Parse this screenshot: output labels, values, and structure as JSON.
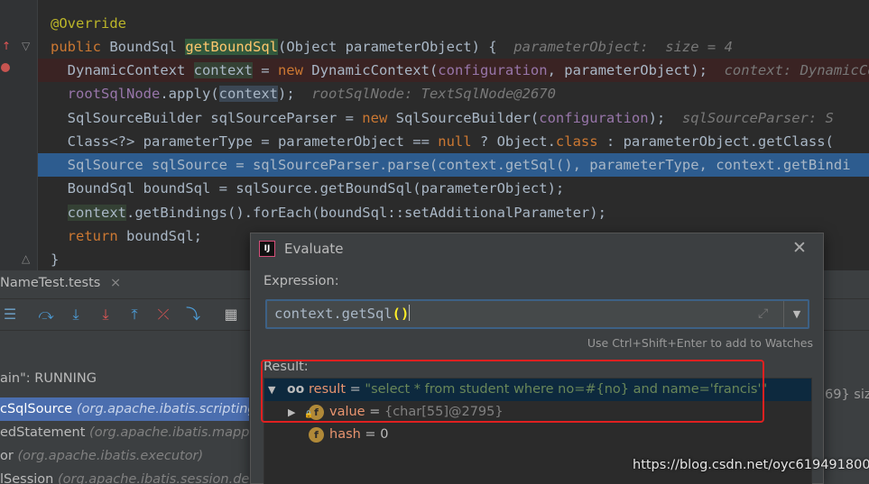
{
  "editor": {
    "lines": [
      {
        "parts": [
          {
            "t": "@Override",
            "c": "ann"
          }
        ]
      },
      {
        "parts": [
          {
            "t": "public ",
            "c": "kw"
          },
          {
            "t": "BoundSql ",
            "c": ""
          },
          {
            "t": "getBoundSql",
            "c": "method-hl"
          },
          {
            "t": "(Object parameterObject) {  ",
            "c": ""
          },
          {
            "t": "parameterObject:  size = 4",
            "c": "hint"
          }
        ]
      },
      {
        "parts": [
          {
            "t": "  DynamicContext ",
            "c": ""
          },
          {
            "t": "context",
            "c": "var-hl"
          },
          {
            "t": " = ",
            "c": ""
          },
          {
            "t": "new ",
            "c": "kw"
          },
          {
            "t": "DynamicContext(",
            "c": ""
          },
          {
            "t": "configuration",
            "c": "fld"
          },
          {
            "t": ", parameterObject);  ",
            "c": ""
          },
          {
            "t": "context: DynamicCo",
            "c": "hint"
          }
        ]
      },
      {
        "parts": [
          {
            "t": "  ",
            "c": ""
          },
          {
            "t": "rootSqlNode",
            "c": "fld"
          },
          {
            "t": ".apply(",
            "c": ""
          },
          {
            "t": "context",
            "c": "var-hl2"
          },
          {
            "t": ");  ",
            "c": ""
          },
          {
            "t": "rootSqlNode: TextSqlNode@2670",
            "c": "hint"
          }
        ]
      },
      {
        "parts": [
          {
            "t": "  SqlSourceBuilder sqlSourceParser = ",
            "c": ""
          },
          {
            "t": "new ",
            "c": "kw"
          },
          {
            "t": "SqlSourceBuilder(",
            "c": ""
          },
          {
            "t": "configuration",
            "c": "fld"
          },
          {
            "t": ");  ",
            "c": ""
          },
          {
            "t": "sqlSourceParser: S",
            "c": "hint"
          }
        ]
      },
      {
        "parts": [
          {
            "t": "  Class<?> parameterType = parameterObject == ",
            "c": ""
          },
          {
            "t": "null",
            "c": "kw"
          },
          {
            "t": " ? Object.",
            "c": ""
          },
          {
            "t": "class",
            "c": "kw"
          },
          {
            "t": " : parameterObject.getClass(",
            "c": ""
          }
        ]
      },
      {
        "parts": [
          {
            "t": "  SqlSource sqlSource = sqlSourceParser.parse(context.getSql(), parameterType, context.getBindi",
            "c": ""
          }
        ]
      },
      {
        "parts": [
          {
            "t": "  BoundSql boundSql = sqlSource.getBoundSql(parameterObject);",
            "c": ""
          }
        ]
      },
      {
        "parts": [
          {
            "t": "  ",
            "c": ""
          },
          {
            "t": "context",
            "c": "var-hl3"
          },
          {
            "t": ".getBindings().forEach(boundSql::setAdditionalParameter);",
            "c": ""
          }
        ]
      },
      {
        "parts": [
          {
            "t": "  ",
            "c": ""
          },
          {
            "t": "return ",
            "c": "kw"
          },
          {
            "t": "boundSql;",
            "c": ""
          }
        ]
      },
      {
        "parts": [
          {
            "t": "}",
            "c": ""
          }
        ]
      }
    ]
  },
  "debug": {
    "tab_label": "NameTest.tests",
    "tab_close": "×",
    "thread_status": "ain\": RUNNING",
    "frames": [
      {
        "name": "cSqlSource",
        "pkg": " (org.apache.ibatis.scripting"
      },
      {
        "name": "edStatement",
        "pkg": " (org.apache.ibatis.mapping"
      },
      {
        "name": "or",
        "pkg": " (org.apache.ibatis.executor)"
      },
      {
        "name": "lSession",
        "pkg": " (org.apache.ibatis.session.de"
      }
    ],
    "right_vars_text": "69}  siz"
  },
  "dialog": {
    "title": "Evaluate",
    "close_icon": "✕",
    "expression_label": "Expression:",
    "expression_text": "context.getSql",
    "expression_parens": "()",
    "watch_hint": "Use Ctrl+Shift+Enter to add to Watches",
    "result_label": "Result:",
    "result": {
      "name": "result",
      "value": "\"select * from student where no=#{no} and name='francis'\"",
      "children": [
        {
          "name": "value",
          "value": "{char[55]@2795}"
        },
        {
          "name": "hash",
          "value": "0"
        }
      ]
    }
  },
  "colors": {
    "selected_line": "#2d5c8f",
    "breakpoint_line": "#3a2323",
    "highlight_box": "#e02020"
  },
  "watermark": "https://blog.csdn.net/oyc619491800"
}
